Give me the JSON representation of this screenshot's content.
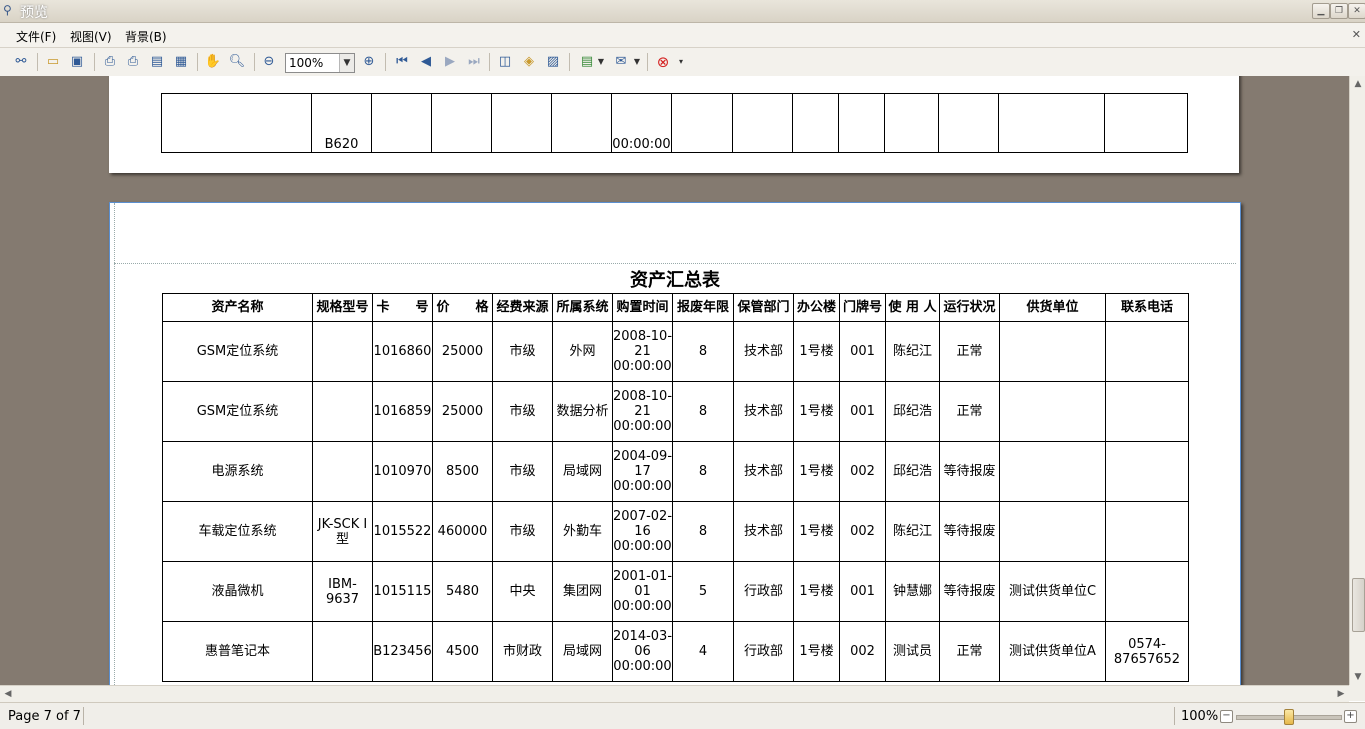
{
  "window": {
    "title": "预览"
  },
  "menu": {
    "items": [
      "文件(F)",
      "视图(V)",
      "背景(B)"
    ]
  },
  "toolbar": {
    "zoom": "100%"
  },
  "report": {
    "title": "资产汇总表",
    "headers": [
      "资产名称",
      "规格型号",
      "卡　　号",
      "价　　格",
      "经费来源",
      "所属系统",
      "购置时间",
      "报废年限",
      "保管部门",
      "办公楼",
      "门牌号",
      "使 用 人",
      "运行状况",
      "供货单位",
      "联系电话"
    ],
    "prev_row": [
      "",
      "B620",
      "",
      "",
      "",
      "",
      "00:00:00",
      "",
      "",
      "",
      "",
      "",
      "",
      "",
      ""
    ],
    "rows": [
      [
        "GSM定位系统",
        "",
        "1016860",
        "25000",
        "市级",
        "外网",
        "2008-10-21 00:00:00",
        "8",
        "技术部",
        "1号楼",
        "001",
        "陈纪江",
        "正常",
        "",
        ""
      ],
      [
        "GSM定位系统",
        "",
        "1016859",
        "25000",
        "市级",
        "数据分析",
        "2008-10-21 00:00:00",
        "8",
        "技术部",
        "1号楼",
        "001",
        "邱纪浩",
        "正常",
        "",
        ""
      ],
      [
        "电源系统",
        "",
        "1010970",
        "8500",
        "市级",
        "局域网",
        "2004-09-17 00:00:00",
        "8",
        "技术部",
        "1号楼",
        "002",
        "邱纪浩",
        "等待报废",
        "",
        ""
      ],
      [
        "车载定位系统",
        "JK-SCK I 型",
        "1015522",
        "460000",
        "市级",
        "外勤车",
        "2007-02-16 00:00:00",
        "8",
        "技术部",
        "1号楼",
        "002",
        "陈纪江",
        "等待报废",
        "",
        ""
      ],
      [
        "液晶微机",
        "IBM-9637",
        "1015115",
        "5480",
        "中央",
        "集团网",
        "2001-01-01 00:00:00",
        "5",
        "行政部",
        "1号楼",
        "001",
        "钟慧娜",
        "等待报废",
        "测试供货单位C",
        ""
      ],
      [
        "惠普笔记本",
        "",
        "B123456",
        "4500",
        "市财政",
        "局域网",
        "2014-03-06 00:00:00",
        "4",
        "行政部",
        "1号楼",
        "002",
        "测试员",
        "正常",
        "测试供货单位A",
        "0574-87657652"
      ]
    ]
  },
  "status": {
    "page": "Page 7 of 7",
    "zoom": "100%"
  }
}
